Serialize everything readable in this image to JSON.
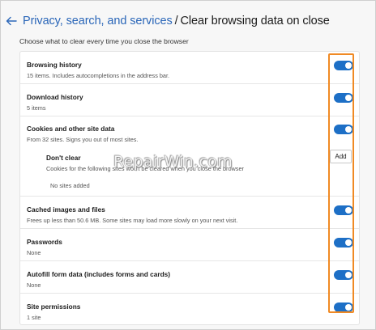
{
  "header": {
    "back_icon": "arrow-left-icon",
    "breadcrumb_link": "Privacy, search, and services",
    "separator": "/",
    "current_page": "Clear browsing data on close"
  },
  "subtitle": "Choose what to clear every time you close the browser",
  "items": [
    {
      "title": "Browsing history",
      "description": "15 items. Includes autocompletions in the address bar.",
      "toggle_on": true
    },
    {
      "title": "Download history",
      "description": "5 items",
      "toggle_on": true
    },
    {
      "title": "Cookies and other site data",
      "description": "From 32 sites. Signs you out of most sites.",
      "toggle_on": true
    },
    {
      "title": "Cached images and files",
      "description": "Frees up less than 50.6 MB. Some sites may load more slowly on your next visit.",
      "toggle_on": true
    },
    {
      "title": "Passwords",
      "description": "None",
      "toggle_on": true
    },
    {
      "title": "Autofill form data (includes forms and cards)",
      "description": "None",
      "toggle_on": true
    },
    {
      "title": "Site permissions",
      "description": "1 site",
      "toggle_on": true
    }
  ],
  "dont_clear": {
    "title": "Don't clear",
    "description": "Cookies for the following sites won't be cleared when you close the browser",
    "empty_text": "No sites added",
    "add_label": "Add"
  },
  "watermark": "RepairWin.com",
  "colors": {
    "link": "#2a66b8",
    "toggle_on": "#1d6fc6",
    "highlight": "#f08a24"
  }
}
